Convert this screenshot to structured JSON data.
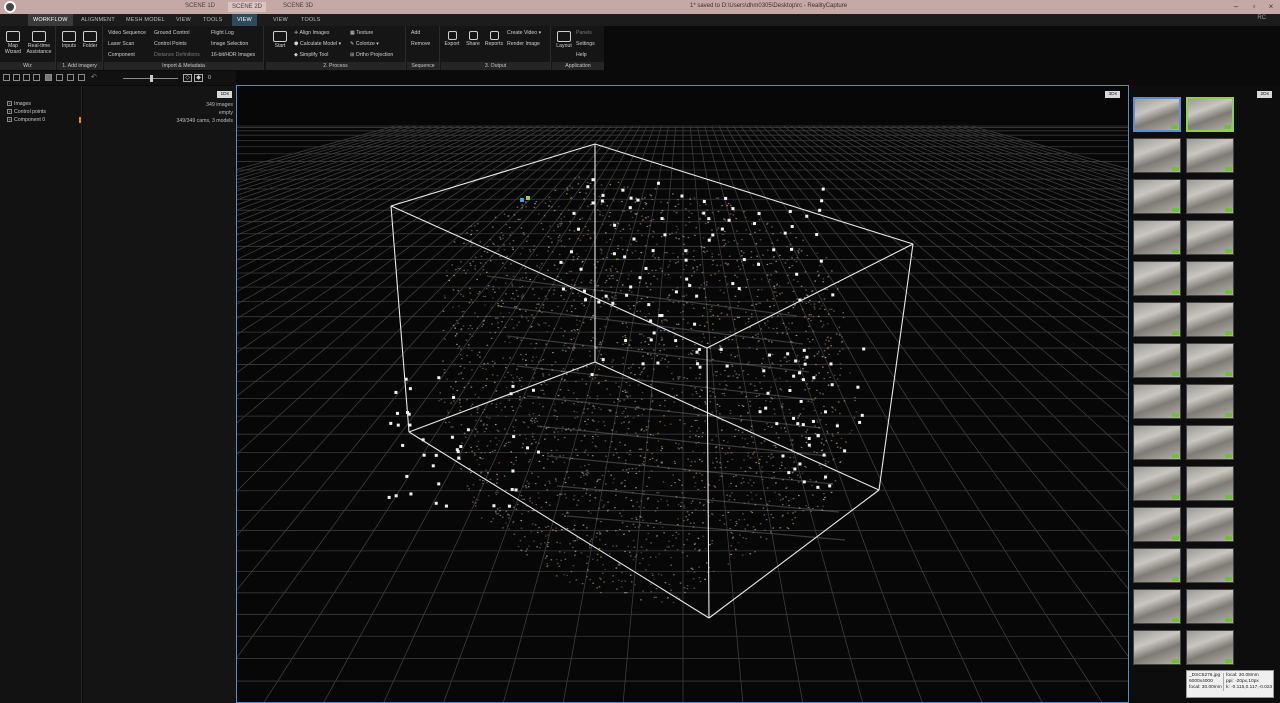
{
  "titlebar": {
    "tabs": [
      "SCENE 1D",
      "SCENE 2D",
      "SCENE 3D"
    ],
    "window_title": "1* saved to D:\\Users\\dhm0305\\Desktop\\rc - RealityCapture",
    "colors": {
      "bar": "#c5a9a7"
    }
  },
  "ribbon_tabs": [
    "WORKFLOW",
    "ALIGNMENT",
    "MESH MODEL",
    "VIEW",
    "TOOLS",
    "VIEW",
    "VIEW",
    "TOOLS"
  ],
  "rc_label": "RC",
  "ribbon": {
    "wiz": {
      "footer": "Wiz",
      "map_wizard": "Map Wizard",
      "realtime": "Real-time Assistance"
    },
    "add_imagery": {
      "footer": "1. Add imagery",
      "inputs": "Inputs",
      "folder": "Folder"
    },
    "import_metadata": {
      "footer": "Import & Metadata",
      "col1": [
        "Video Sequence",
        "Laser Scan",
        "Component"
      ],
      "col2": [
        "Ground Control",
        "Control Points",
        "Distance Definitions"
      ],
      "col3": [
        "Flight Log",
        "Image Selection",
        "16-bit/HDR Images"
      ]
    },
    "process": {
      "footer": "2. Process",
      "start": "Start",
      "col1": [
        "Align Images",
        "Calculate Model",
        "Simplify Tool"
      ],
      "col2": [
        "Texture",
        "Colorize",
        "Ortho Projection"
      ]
    },
    "sequence": {
      "footer": "Sequence",
      "items": [
        "Add",
        "Remove"
      ]
    },
    "output": {
      "footer": "3. Output",
      "export": "Export",
      "share": "Share",
      "reports": "Reports",
      "items": [
        "Create Video",
        "Render Image"
      ]
    },
    "application": {
      "footer": "Application",
      "layout": "Layout",
      "items": [
        "Panels",
        "Settings",
        "Help"
      ]
    }
  },
  "toolrow": {
    "zoom_value": "0"
  },
  "tree": {
    "items": [
      "Images",
      "Control points",
      "Component 0"
    ]
  },
  "info": {
    "badge": "1Ds",
    "values": [
      "349 images",
      "empty",
      "349/349 cams, 3 models"
    ]
  },
  "viewport": {
    "badge": "3Ds"
  },
  "imgpanel": {
    "badge": "2Ds"
  },
  "tooltip": {
    "left": [
      "_DSC5276.jpg",
      "6000x4000",
      "focal: 30.00mm"
    ],
    "right": [
      "focal: 30.08mm",
      "ppi: -20px,10px",
      "k: -0.115,0.117,-0.023"
    ]
  },
  "colors": {
    "viewport_border": "#4a8fd0",
    "point_cloud": "#9a9a9a",
    "accent_green": "#8ed04a"
  }
}
